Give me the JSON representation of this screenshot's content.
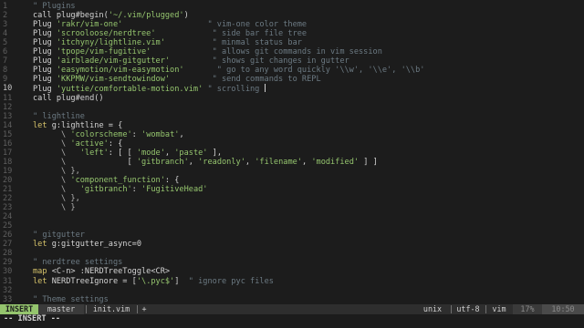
{
  "colors": {
    "comment": "#6c7a83",
    "keyword": "#d6c36a",
    "string": "#95c56e",
    "mode_bg": "#95c56e"
  },
  "lines": [
    {
      "n": "1",
      "segs": [
        {
          "c": "c",
          "t": "\" Plugins"
        }
      ]
    },
    {
      "n": "2",
      "segs": [
        {
          "c": "t",
          "t": "call plug#begin("
        },
        {
          "c": "s",
          "t": "'~/.vim/plugged'"
        },
        {
          "c": "t",
          "t": ")"
        }
      ]
    },
    {
      "n": "3",
      "segs": [
        {
          "c": "t",
          "t": "Plug "
        },
        {
          "c": "s",
          "t": "'rakr/vim-one'"
        },
        {
          "c": "c",
          "t": "                  \" vim-one color theme"
        }
      ]
    },
    {
      "n": "4",
      "segs": [
        {
          "c": "t",
          "t": "Plug "
        },
        {
          "c": "s",
          "t": "'scrooloose/nerdtree'"
        },
        {
          "c": "c",
          "t": "            \" side bar file tree"
        }
      ]
    },
    {
      "n": "5",
      "segs": [
        {
          "c": "t",
          "t": "Plug "
        },
        {
          "c": "s",
          "t": "'itchyny/lightline.vim'"
        },
        {
          "c": "c",
          "t": "          \" minmal status bar"
        }
      ]
    },
    {
      "n": "6",
      "segs": [
        {
          "c": "t",
          "t": "Plug "
        },
        {
          "c": "s",
          "t": "'tpope/vim-fugitive'"
        },
        {
          "c": "c",
          "t": "             \" allows git commands in vim session"
        }
      ]
    },
    {
      "n": "7",
      "segs": [
        {
          "c": "t",
          "t": "Plug "
        },
        {
          "c": "s",
          "t": "'airblade/vim-gitgutter'"
        },
        {
          "c": "c",
          "t": "         \" shows git changes in gutter"
        }
      ]
    },
    {
      "n": "8",
      "segs": [
        {
          "c": "t",
          "t": "Plug "
        },
        {
          "c": "s",
          "t": "'easymotion/vim-easymotion'"
        },
        {
          "c": "c",
          "t": "       \" go to any word quickly '\\\\w', '\\\\e', '\\\\b'"
        }
      ]
    },
    {
      "n": "9",
      "segs": [
        {
          "c": "t",
          "t": "Plug "
        },
        {
          "c": "s",
          "t": "'KKPMW/vim-sendtowindow'"
        },
        {
          "c": "c",
          "t": "         \" send commands to REPL"
        }
      ]
    },
    {
      "n": "10",
      "segs": [
        {
          "c": "t",
          "t": "Plug "
        },
        {
          "c": "s",
          "t": "'yuttie/comfortable-motion.vim'"
        },
        {
          "c": "c",
          "t": " \" scrolling "
        }
      ],
      "cursor": true
    },
    {
      "n": "11",
      "segs": [
        {
          "c": "t",
          "t": "call plug#end()"
        }
      ]
    },
    {
      "n": "12",
      "segs": []
    },
    {
      "n": "13",
      "segs": [
        {
          "c": "c",
          "t": "\" lightline"
        }
      ]
    },
    {
      "n": "14",
      "segs": [
        {
          "c": "k",
          "t": "let "
        },
        {
          "c": "t",
          "t": "g:lightline = {"
        }
      ]
    },
    {
      "n": "15",
      "segs": [
        {
          "c": "p",
          "t": "      \\ "
        },
        {
          "c": "s",
          "t": "'colorscheme'"
        },
        {
          "c": "t",
          "t": ": "
        },
        {
          "c": "s",
          "t": "'wombat'"
        },
        {
          "c": "t",
          "t": ","
        }
      ]
    },
    {
      "n": "16",
      "segs": [
        {
          "c": "p",
          "t": "      \\ "
        },
        {
          "c": "s",
          "t": "'active'"
        },
        {
          "c": "t",
          "t": ": {"
        }
      ]
    },
    {
      "n": "17",
      "segs": [
        {
          "c": "p",
          "t": "      \\   "
        },
        {
          "c": "s",
          "t": "'left'"
        },
        {
          "c": "t",
          "t": ": [ [ "
        },
        {
          "c": "s",
          "t": "'mode'"
        },
        {
          "c": "t",
          "t": ", "
        },
        {
          "c": "s",
          "t": "'paste'"
        },
        {
          "c": "t",
          "t": " ],"
        }
      ]
    },
    {
      "n": "18",
      "segs": [
        {
          "c": "p",
          "t": "      \\             "
        },
        {
          "c": "t",
          "t": "[ "
        },
        {
          "c": "s",
          "t": "'gitbranch'"
        },
        {
          "c": "t",
          "t": ", "
        },
        {
          "c": "s",
          "t": "'readonly'"
        },
        {
          "c": "t",
          "t": ", "
        },
        {
          "c": "s",
          "t": "'filename'"
        },
        {
          "c": "t",
          "t": ", "
        },
        {
          "c": "s",
          "t": "'modified'"
        },
        {
          "c": "t",
          "t": " ] ]"
        }
      ]
    },
    {
      "n": "19",
      "segs": [
        {
          "c": "p",
          "t": "      \\ },"
        }
      ]
    },
    {
      "n": "20",
      "segs": [
        {
          "c": "p",
          "t": "      \\ "
        },
        {
          "c": "s",
          "t": "'component_function'"
        },
        {
          "c": "t",
          "t": ": {"
        }
      ]
    },
    {
      "n": "21",
      "segs": [
        {
          "c": "p",
          "t": "      \\   "
        },
        {
          "c": "s",
          "t": "'gitbranch'"
        },
        {
          "c": "t",
          "t": ": "
        },
        {
          "c": "s",
          "t": "'FugitiveHead'"
        }
      ]
    },
    {
      "n": "22",
      "segs": [
        {
          "c": "p",
          "t": "      \\ },"
        }
      ]
    },
    {
      "n": "23",
      "segs": [
        {
          "c": "p",
          "t": "      \\ }"
        }
      ]
    },
    {
      "n": "24",
      "segs": []
    },
    {
      "n": "25",
      "segs": []
    },
    {
      "n": "26",
      "segs": [
        {
          "c": "c",
          "t": "\" gitgutter"
        }
      ]
    },
    {
      "n": "27",
      "segs": [
        {
          "c": "k",
          "t": "let "
        },
        {
          "c": "t",
          "t": "g:gitgutter_async=0"
        }
      ]
    },
    {
      "n": "28",
      "segs": []
    },
    {
      "n": "29",
      "segs": [
        {
          "c": "c",
          "t": "\" nerdtree settings"
        }
      ]
    },
    {
      "n": "30",
      "segs": [
        {
          "c": "k",
          "t": "map "
        },
        {
          "c": "t",
          "t": "<C-n> :NERDTreeToggle<CR>"
        }
      ]
    },
    {
      "n": "31",
      "segs": [
        {
          "c": "k",
          "t": "let "
        },
        {
          "c": "t",
          "t": "NERDTreeIgnore = ["
        },
        {
          "c": "s",
          "t": "'\\.pyc$'"
        },
        {
          "c": "t",
          "t": "]  "
        },
        {
          "c": "c",
          "t": "\" ignore pyc files"
        }
      ]
    },
    {
      "n": "32",
      "segs": []
    },
    {
      "n": "33",
      "segs": [
        {
          "c": "c",
          "t": "\" Theme settings"
        }
      ]
    }
  ],
  "statusline": {
    "mode": "INSERT",
    "branch": "master",
    "sep": "|",
    "file": "init.vim",
    "modified": "+",
    "fileformat": "unix",
    "encoding": "utf-8",
    "filetype": "vim",
    "percent": "17%",
    "position": "10:50"
  },
  "cmdline": "-- INSERT --"
}
